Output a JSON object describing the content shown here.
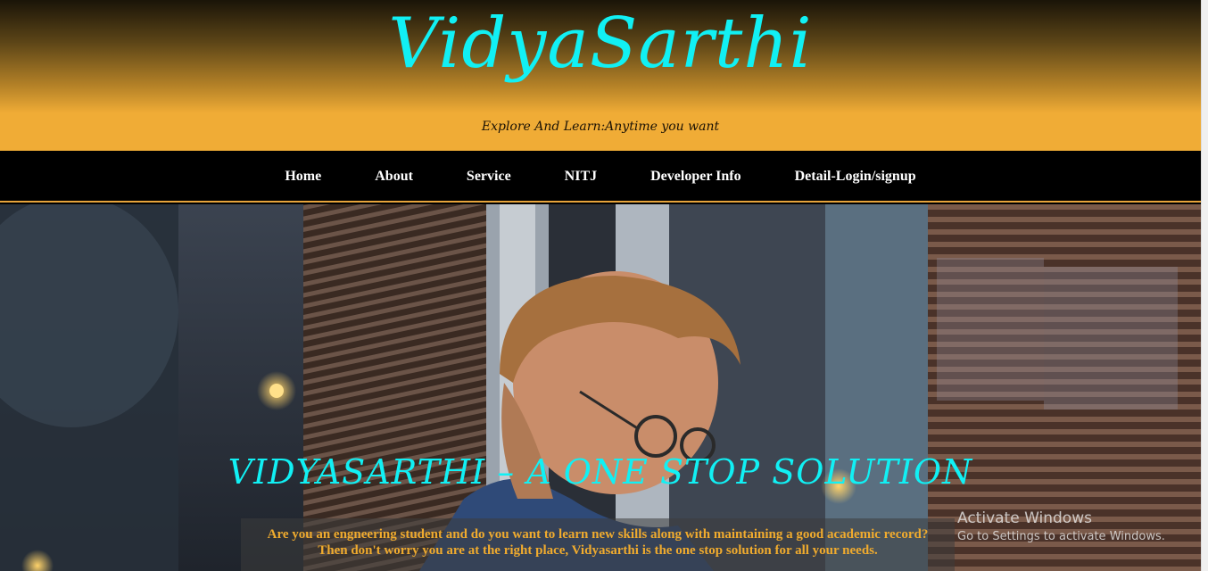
{
  "header": {
    "brand_title": "VidyaSarthi",
    "tagline": "Explore And Learn:Anytime you want"
  },
  "nav": {
    "items": [
      {
        "label": "Home"
      },
      {
        "label": "About"
      },
      {
        "label": "Service"
      },
      {
        "label": "NITJ"
      },
      {
        "label": "Developer Info"
      },
      {
        "label": "Detail-Login/signup"
      }
    ]
  },
  "hero": {
    "heading": "VIDYASARTHI – A ONE STOP SOLUTION",
    "line1": "Are you an engneering student and do you want to learn new skills along with maintaining a good academic record?",
    "line2": "Then don't worry you are at the right place, Vidyasarthi is the one stop solution for all your needs."
  },
  "watermark": {
    "title": "Activate Windows",
    "subtitle": "Go to Settings to activate Windows."
  },
  "colors": {
    "accent_cyan": "#11f0f4",
    "header_gold": "#f0ac36",
    "nav_bg": "#000000",
    "hero_text_gold": "#f0ab2e"
  }
}
